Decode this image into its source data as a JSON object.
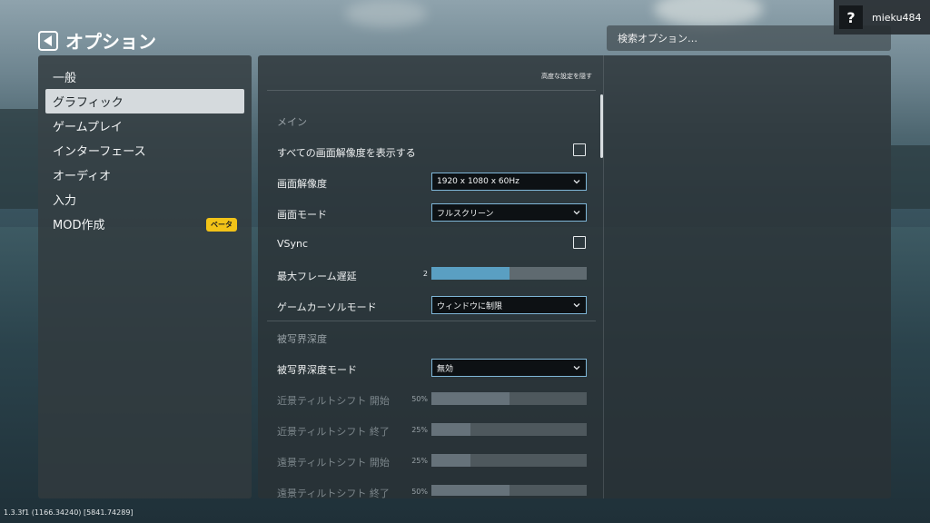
{
  "title": "オプション",
  "user": {
    "help_label": "?",
    "name": "mieku484"
  },
  "search": {
    "placeholder": "検索オプション…"
  },
  "sidebar": {
    "items": [
      {
        "label": "一般"
      },
      {
        "label": "グラフィック",
        "active": true
      },
      {
        "label": "ゲームプレイ"
      },
      {
        "label": "インターフェース"
      },
      {
        "label": "オーディオ"
      },
      {
        "label": "入力"
      },
      {
        "label": "MOD作成",
        "badge": "ベータ"
      }
    ]
  },
  "main": {
    "hide_advanced": "高度な設定を隠す",
    "section_main": "メイン",
    "show_all_resolutions": {
      "label": "すべての画面解像度を表示する",
      "checked": false
    },
    "resolution": {
      "label": "画面解像度",
      "value": "1920 x 1080 x 60Hz"
    },
    "screen_mode": {
      "label": "画面モード",
      "value": "フルスクリーン"
    },
    "vsync": {
      "label": "VSync",
      "checked": false
    },
    "max_frame_latency": {
      "label": "最大フレーム遅延",
      "value_text": "2",
      "fraction": 0.5
    },
    "cursor_mode": {
      "label": "ゲームカーソルモード",
      "value": "ウィンドウに制限"
    },
    "section_dof": "被写界深度",
    "dof_mode": {
      "label": "被写界深度モード",
      "value": "無効"
    },
    "near_tilt_start": {
      "label": "近景ティルトシフト 開始",
      "value_text": "50%",
      "fraction": 0.5
    },
    "near_tilt_end": {
      "label": "近景ティルトシフト 終了",
      "value_text": "25%",
      "fraction": 0.25
    },
    "far_tilt_start": {
      "label": "遠景ティルトシフト 開始",
      "value_text": "25%",
      "fraction": 0.25
    },
    "far_tilt_end": {
      "label": "遠景ティルトシフト 終了",
      "value_text": "50%",
      "fraction": 0.5
    }
  },
  "version": "1.3.3f1 (1166.34240) [5841.74289]",
  "colors": {
    "accent": "#5a9fc2",
    "beta_badge": "#f2c318",
    "active_tab": "#d5dadd"
  }
}
